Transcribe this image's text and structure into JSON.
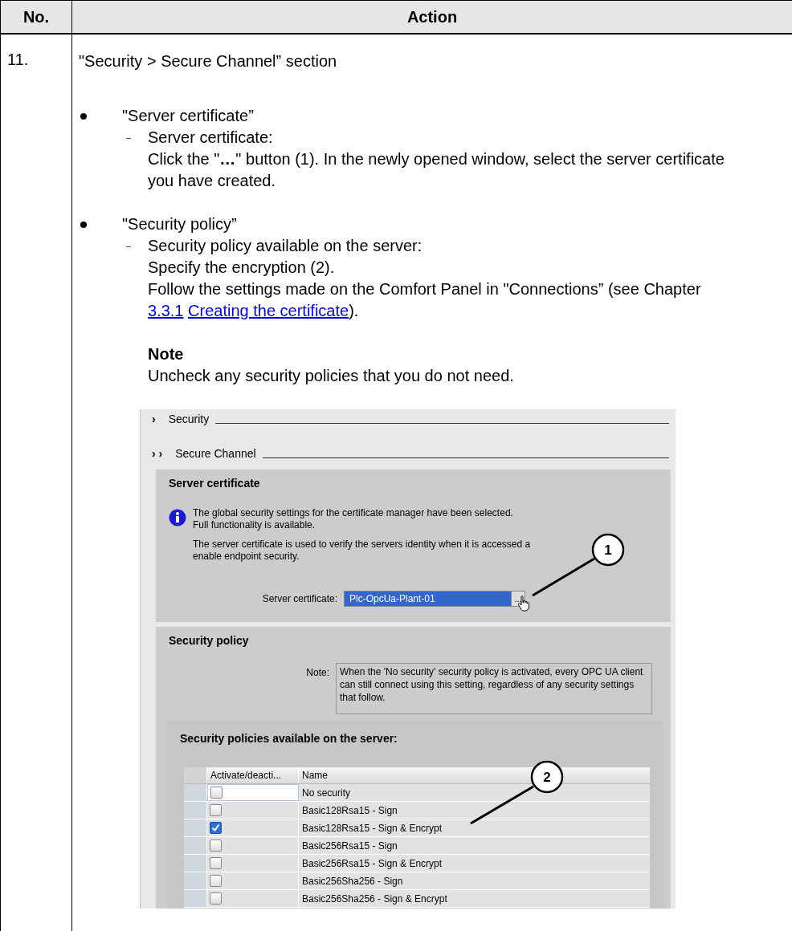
{
  "table": {
    "columns": [
      "No.",
      "Action"
    ],
    "rows": [
      {
        "number": "11.",
        "heading": "\"Security > Secure Channel” section",
        "bullets": [
          {
            "title": "\"Server certificate”",
            "items": [
              {
                "lines": [
                  {
                    "kind": "text",
                    "text": "Server certificate:"
                  },
                  {
                    "kind": "text",
                    "text": "Click the \"**…**\" button (1). In the newly opened window, select the server certificate you have created."
                  }
                ]
              }
            ]
          },
          {
            "title": "\"Security policy”",
            "items": [
              {
                "lines": [
                  {
                    "kind": "text",
                    "text": "Security policy available on the server:"
                  },
                  {
                    "kind": "text",
                    "text": "Specify the encryption (2)."
                  },
                  {
                    "kind": "parts",
                    "parts": [
                      {
                        "kind": "text",
                        "text": "Follow the settings made on the Comfort Panel in \"Connections” (see Chapter "
                      },
                      {
                        "kind": "link",
                        "text": "3.3.1"
                      },
                      {
                        "kind": "link",
                        "text": "Creating the certificate"
                      },
                      {
                        "kind": "text",
                        "text": ")."
                      }
                    ]
                  }
                ]
              }
            ]
          }
        ],
        "note": {
          "title": "Note",
          "text": "Uncheck any security policies that you do not need."
        },
        "screenshot": {
          "headings": [
            {
              "chevron": "›",
              "label": "Security"
            },
            {
              "chevron": "› ›",
              "label": "Secure Channel"
            }
          ],
          "server_certificate": {
            "title": "Server certificate",
            "info": [
              [
                "The global security settings for the certificate manager have been selected.",
                "Full functionality is available."
              ],
              [
                "The server certificate is used to verify the servers identity when it is accessed a",
                "enable endpoint security."
              ]
            ],
            "field_label": "Server certificate:",
            "field_value": "Plc-OpcUa-Plant-01",
            "browse_button": "..."
          },
          "security_policy": {
            "title": "Security policy",
            "note_label": "Note:",
            "note_text": "When the 'No security' security policy is activated, every OPC UA client can still connect using this setting, regardless of any security settings that follow.",
            "policies": {
              "title": "Security policies available on the server:",
              "columns": [
                "Activate/deacti...",
                "Name"
              ],
              "rows": [
                {
                  "name": "No security",
                  "checked": false,
                  "selected": true
                },
                {
                  "name": "Basic128Rsa15 - Sign",
                  "checked": false,
                  "selected": false
                },
                {
                  "name": "Basic128Rsa15 - Sign & Encrypt",
                  "checked": true,
                  "selected": false
                },
                {
                  "name": "Basic256Rsa15 - Sign",
                  "checked": false,
                  "selected": false
                },
                {
                  "name": "Basic256Rsa15 - Sign & Encrypt",
                  "checked": false,
                  "selected": false
                },
                {
                  "name": "Basic256Sha256 - Sign",
                  "checked": false,
                  "selected": false
                },
                {
                  "name": "Basic256Sha256 - Sign & Encrypt",
                  "checked": false,
                  "selected": false
                }
              ]
            }
          },
          "callouts": [
            {
              "number": "1"
            },
            {
              "number": "2"
            }
          ]
        }
      }
    ]
  }
}
